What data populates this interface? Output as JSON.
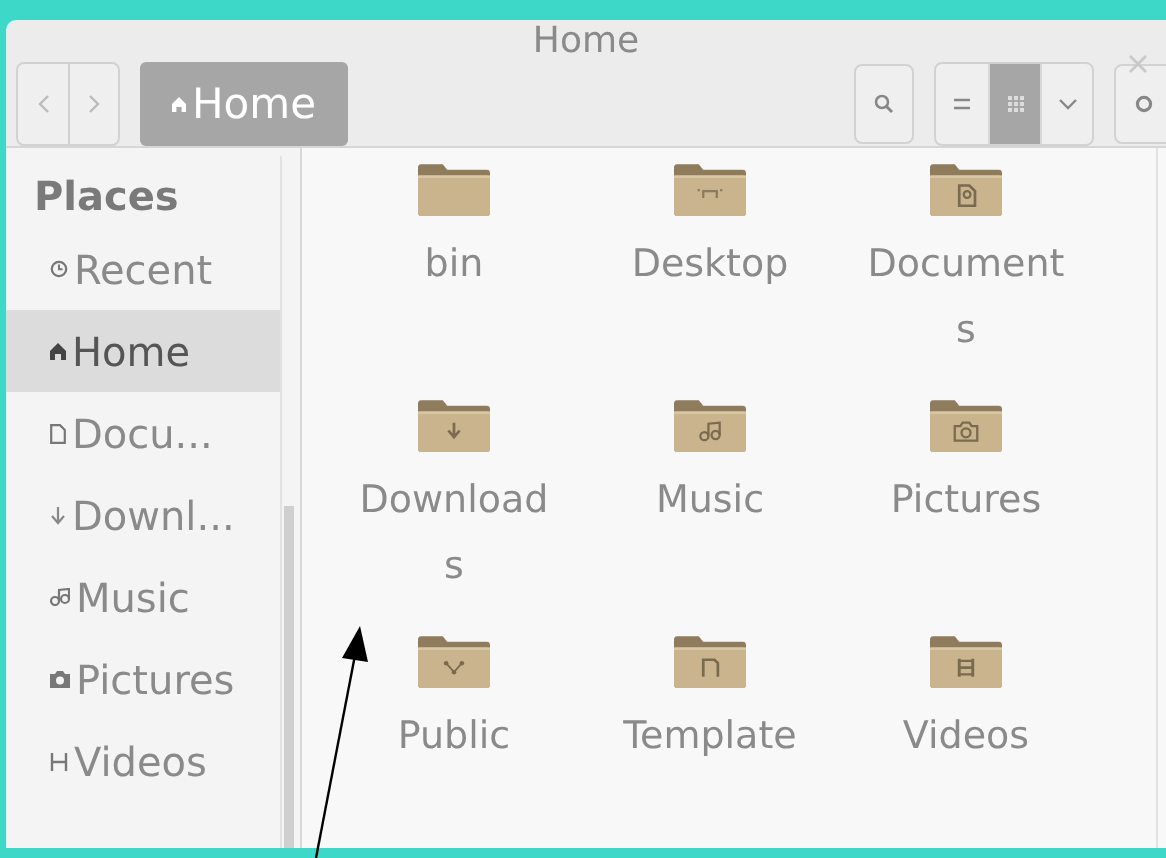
{
  "window": {
    "title": "Home"
  },
  "toolbar": {
    "path": [
      {
        "label": "Home",
        "kind": "home",
        "selected": true
      }
    ],
    "view": {
      "list_selected": false,
      "grid_selected": true
    }
  },
  "sidebar": {
    "heading": "Places",
    "items": [
      {
        "label": "Recent",
        "kind": "recent",
        "selected": false
      },
      {
        "label": "Home",
        "kind": "home",
        "selected": true
      },
      {
        "label": "Docu...",
        "kind": "documents",
        "selected": false
      },
      {
        "label": "Downl...",
        "kind": "downloads",
        "selected": false
      },
      {
        "label": "Music",
        "kind": "music",
        "selected": false
      },
      {
        "label": "Pictures",
        "kind": "pictures",
        "selected": false
      },
      {
        "label": "Videos",
        "kind": "videos",
        "selected": false
      }
    ]
  },
  "files": [
    {
      "name": "bin",
      "kind": "plain"
    },
    {
      "name": "Desktop",
      "kind": "desktop"
    },
    {
      "name": "Documents",
      "kind": "documents"
    },
    {
      "name": "Downloads",
      "kind": "downloads"
    },
    {
      "name": "Music",
      "kind": "music"
    },
    {
      "name": "Pictures",
      "kind": "pictures"
    },
    {
      "name": "Public",
      "kind": "public"
    },
    {
      "name": "Template",
      "kind": "templates"
    },
    {
      "name": "Videos",
      "kind": "videos"
    }
  ],
  "annotation": {
    "kind": "arrow"
  }
}
